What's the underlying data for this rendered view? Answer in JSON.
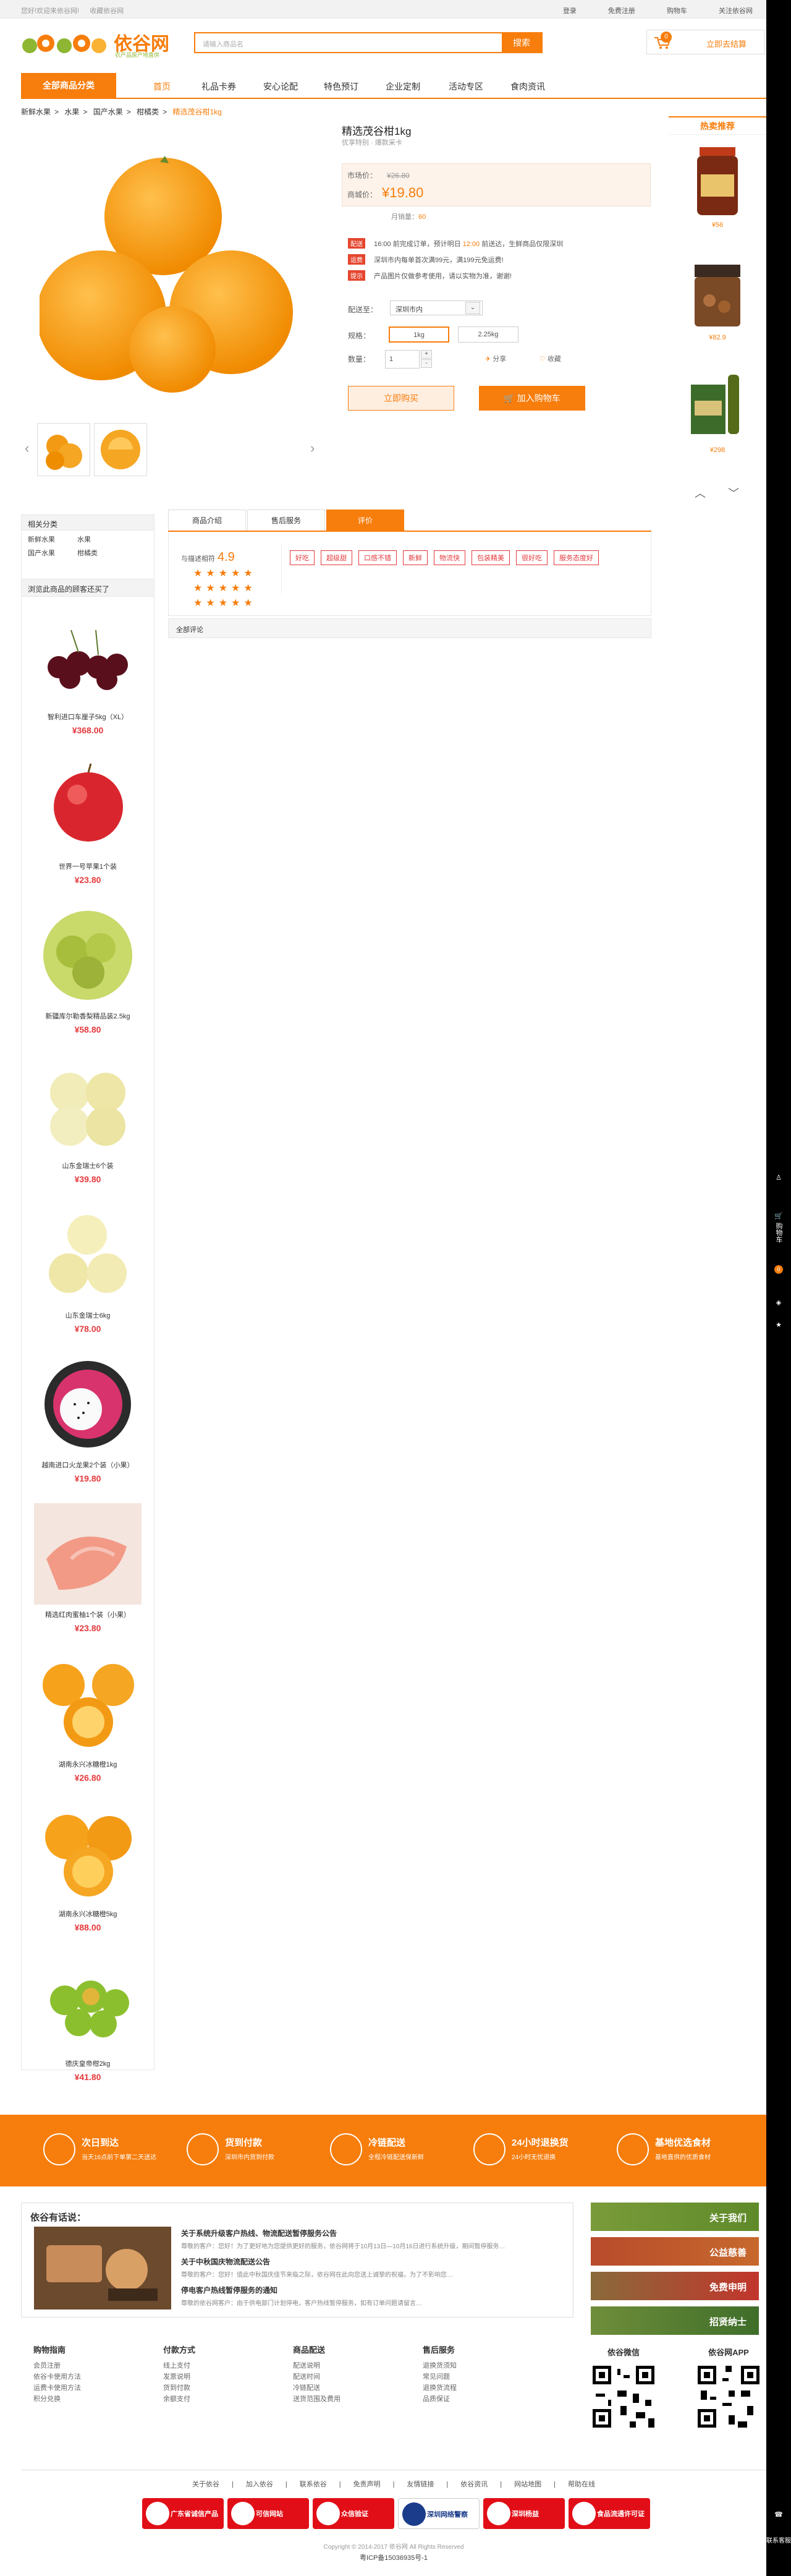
{
  "topbar": {
    "welcome": "您好!欢迎来依谷网!",
    "fav": "收藏依谷网",
    "login": "登录",
    "register": "免费注册",
    "cart": "购物车",
    "follow": "关注依谷网"
  },
  "header": {
    "logo_text": "依谷网",
    "logo_sub": "农产品原产地直供",
    "search_placeholder": "请输入商品名",
    "search_btn": "搜索",
    "cart_count": "0",
    "cart_label": "立即去结算"
  },
  "nav": {
    "category": "全部商品分类",
    "items": [
      "首页",
      "礼品卡券",
      "安心论配",
      "特色预订",
      "企业定制",
      "活动专区",
      "食肉资讯"
    ]
  },
  "breadcrumb": [
    "新鲜水果",
    "水果",
    "国产水果",
    "柑橘类",
    "精选茂谷柑1kg"
  ],
  "product": {
    "name": "精选茂谷柑1kg",
    "spec": "优享特别 · 爆款采卡",
    "market_label": "市场价：",
    "market_price": "¥26.80",
    "shop_label": "商城价：",
    "shop_price": "¥19.80",
    "sales_label": "月销量：",
    "sales": "60",
    "promos": [
      {
        "tag": "配送",
        "text": "16:00 前完成订单，预计明日 ",
        "hl": "12:00",
        "text2": " 前送达，生鲜商品仅限深圳"
      },
      {
        "tag": "运费",
        "text": "深圳市内每单首次满99元，满199元免运费!",
        "hl": "",
        "text2": ""
      },
      {
        "tag": "提示",
        "text": "产品图片仅做参考使用，请以实物为准，谢谢!",
        "hl": "",
        "text2": ""
      }
    ],
    "ship_label": "配送至：",
    "ship_value": "深圳市内",
    "spec_label": "规格：",
    "spec_options": [
      "1kg",
      "2.25kg"
    ],
    "qty_label": "数量：",
    "qty": "1",
    "share": "分享",
    "favorite": "收藏",
    "buy_now": "立即购买",
    "add_cart": "加入购物车"
  },
  "hot": {
    "title": "热卖推荐",
    "items": [
      {
        "price": "¥56"
      },
      {
        "price": "¥82.9"
      },
      {
        "price": "¥298"
      }
    ]
  },
  "related": {
    "title": "相关分类",
    "rows": [
      [
        "新鲜水果",
        "水果"
      ],
      [
        "国产水果",
        "柑橘类"
      ]
    ]
  },
  "browse": {
    "title": "浏览此商品的顾客还买了",
    "items": [
      {
        "name": "智利进口车厘子5kg（XL）",
        "price": "¥368.00"
      },
      {
        "name": "世界一号苹果1个装",
        "price": "¥23.80"
      },
      {
        "name": "新疆库尔勒香梨精品装2.5kg",
        "price": "¥58.80"
      },
      {
        "name": "山东金瑞士6个装",
        "price": "¥39.80"
      },
      {
        "name": "山东金瑞士6kg",
        "price": "¥78.00"
      },
      {
        "name": "越南进口火龙果2个装（小果）",
        "price": "¥19.80"
      },
      {
        "name": "精选红肉蜜柚1个装（小果）",
        "price": "¥23.80"
      },
      {
        "name": "湖南永兴冰糖橙1kg",
        "price": "¥26.80"
      },
      {
        "name": "湖南永兴冰糖橙5kg",
        "price": "¥88.00"
      },
      {
        "name": "德庆皇帝柑2kg",
        "price": "¥41.80"
      }
    ]
  },
  "tabs": [
    "商品介绍",
    "售后服务",
    "评价"
  ],
  "review": {
    "score_label": "与描述相符",
    "score": "4.9",
    "tags": [
      "好吃",
      "超级甜",
      "口感不错",
      "新鲜",
      "物流快",
      "包装精美",
      "很好吃",
      "服务态度好"
    ],
    "all": "全部评论"
  },
  "services": [
    {
      "title": "次日到达",
      "desc": "当天16点前下单第二天送达"
    },
    {
      "title": "货到付款",
      "desc": "深圳市内货到付款"
    },
    {
      "title": "冷链配送",
      "desc": "全程冷链配送保新鲜"
    },
    {
      "title": "24小时退换货",
      "desc": "24小时无忧退换"
    },
    {
      "title": "基地优选食材",
      "desc": "基地直供的优质食材"
    }
  ],
  "news": {
    "title": "依谷有话说：",
    "items": [
      {
        "t": "关于系统升级客户热线、物流配送暂停服务公告",
        "d": "尊敬的客户：您好！为了更好地为您提供更好的服务，依谷网将于10月13日—10月16日进行系统升级，期间暂停服务…"
      },
      {
        "t": "关于中秋国庆物流配送公告",
        "d": "尊敬的客户：您好！值此中秋国庆佳节来临之际，依谷网在此向您送上诚挚的祝福，为了不影响您…"
      },
      {
        "t": "停电客户热线暂停服务的通知",
        "d": "尊敬的依谷网客户：由于供电部门计划停电，客户热线暂停服务，如有订单问题请留言…"
      }
    ]
  },
  "feature_btns": [
    "关于我们",
    "公益慈善",
    "免费申明",
    "招贤纳士"
  ],
  "footer": {
    "cols": [
      {
        "h": "购物指南",
        "items": [
          "会员注册",
          "依谷卡使用方法",
          "运费卡使用方法",
          "积分兑换"
        ]
      },
      {
        "h": "付款方式",
        "items": [
          "线上支付",
          "发票说明",
          "货到付款",
          "余额支付"
        ]
      },
      {
        "h": "商品配送",
        "items": [
          "配送说明",
          "配送时间",
          "冷链配送",
          "送货范围及费用"
        ]
      },
      {
        "h": "售后服务",
        "items": [
          "退换货须知",
          "常见问题",
          "退换货流程",
          "品质保证"
        ]
      }
    ],
    "qr1": "依谷微信",
    "qr2": "依谷网APP",
    "links": [
      "关于依谷",
      "加入依谷",
      "联系依谷",
      "免责声明",
      "友情链接",
      "依谷资讯",
      "网站地图",
      "帮助在线"
    ],
    "badges": [
      "广东省诚信产品",
      "可信网站",
      "众信验证",
      "深圳网络警察",
      "深圳杨益",
      "食品流通许可证"
    ],
    "copyright": "Copyright © 2014-2017 依谷网 All Rights Reserved",
    "icp": "粤ICP备15036935号-1"
  },
  "rail": {
    "cart_label": "购物车",
    "cart_count": "0",
    "contact": "联系客服"
  }
}
